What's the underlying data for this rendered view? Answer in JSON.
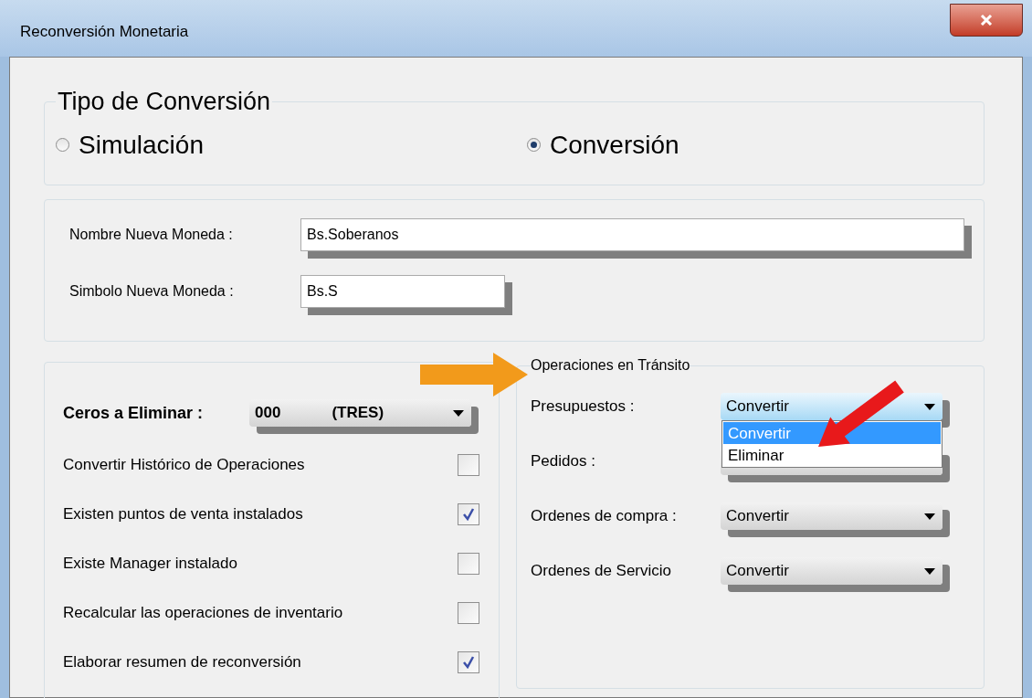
{
  "window": {
    "title": "Reconversión Monetaria"
  },
  "conversion_type": {
    "legend": "Tipo de Conversión",
    "options": [
      {
        "label": "Simulación",
        "selected": false
      },
      {
        "label": "Conversión",
        "selected": true
      }
    ]
  },
  "currency": {
    "fields": [
      {
        "label": "Nombre Nueva Moneda :",
        "value": "Bs.Soberanos",
        "kind": "wide"
      },
      {
        "label": "Simbolo Nueva Moneda :",
        "value": "Bs.S",
        "kind": "narrow"
      }
    ]
  },
  "options": {
    "zeros": {
      "label": "Ceros a Eliminar :",
      "value": "000",
      "value_word": "(TRES)"
    },
    "checkboxes": [
      {
        "label": "Convertir Histórico de Operaciones",
        "checked": false
      },
      {
        "label": "Existen puntos de venta instalados",
        "checked": true
      },
      {
        "label": "Existe Manager  instalado",
        "checked": false
      },
      {
        "label": "Recalcular las operaciones de inventario",
        "checked": false
      },
      {
        "label": "Elaborar resumen de reconversión",
        "checked": true
      }
    ]
  },
  "transit": {
    "legend": "Operaciones en Tránsito",
    "rows": [
      {
        "label": "Presupuestos :",
        "value": "Convertir",
        "expanded": true,
        "options": [
          {
            "label": "Convertir",
            "selected": true
          },
          {
            "label": "Eliminar",
            "selected": false
          }
        ]
      },
      {
        "label": "Pedidos :",
        "expanded": false
      },
      {
        "label": "Ordenes de compra :",
        "value": "Convertir",
        "expanded": false
      },
      {
        "label": "Ordenes de Servicio",
        "value": "Convertir",
        "expanded": false
      }
    ]
  }
}
